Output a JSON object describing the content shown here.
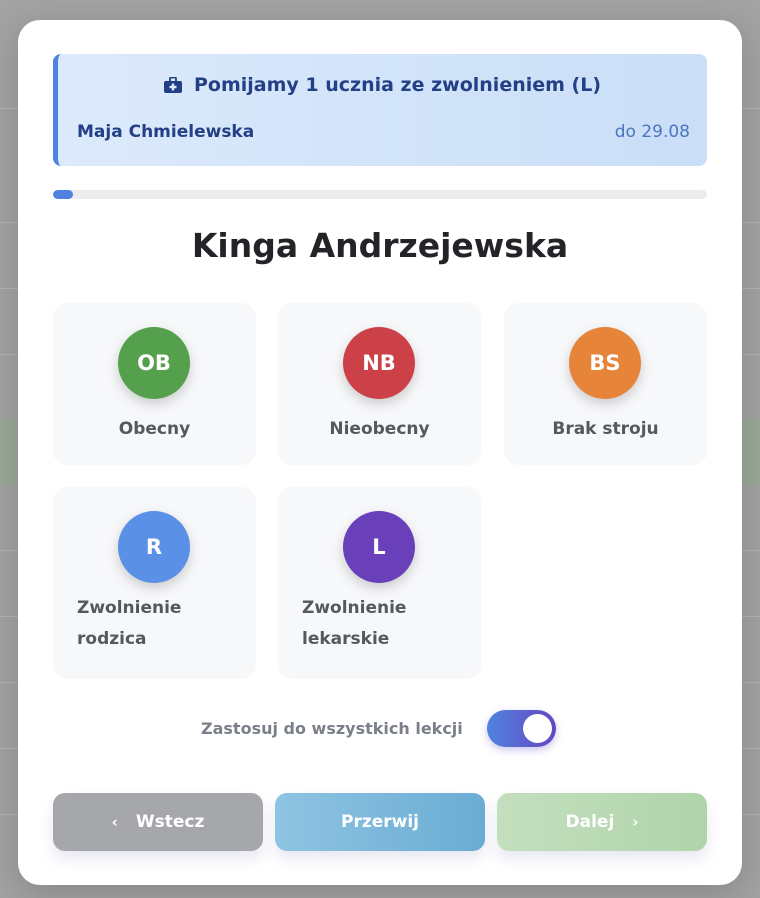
{
  "notice": {
    "icon": "medkit-icon",
    "title": "Pomijamy 1 ucznia ze zwolnieniem (L)",
    "student": "Maja Chmielewska",
    "until": "do 29.08"
  },
  "progress": {
    "fraction": 0.03
  },
  "student_name": "Kinga Andrzejewska",
  "options": [
    {
      "code": "OB",
      "label": "Obecny",
      "color": "#55a04c"
    },
    {
      "code": "NB",
      "label": "Nieobecny",
      "color": "#cc4147"
    },
    {
      "code": "BS",
      "label": "Brak stroju",
      "color": "#e6843a"
    },
    {
      "code": "R",
      "label_line1": "Zwolnienie",
      "label_line2": "rodzica",
      "color": "#5b90e7"
    },
    {
      "code": "L",
      "label_line1": "Zwolnienie",
      "label_line2": "lekarskie",
      "color": "#6a3fba"
    }
  ],
  "apply_all": {
    "label": "Zastosuj do wszystkich lekcji",
    "enabled": true
  },
  "buttons": {
    "back": "Wstecz",
    "stop": "Przerwij",
    "next": "Dalej",
    "back_icon": "chevron-left-icon",
    "next_icon": "chevron-right-icon"
  },
  "colors": {
    "accent": "#4f83df",
    "notice_text": "#233f86"
  }
}
